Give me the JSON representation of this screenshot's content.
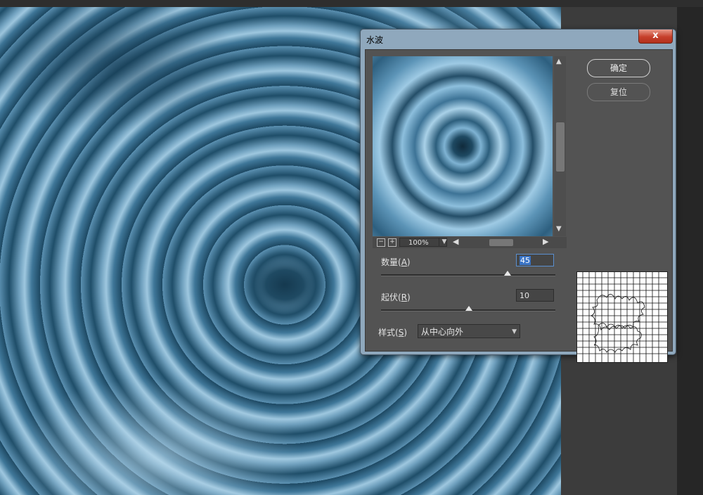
{
  "dialog": {
    "title": "水波",
    "close_label": "x",
    "ok_label": "确定",
    "reset_label": "复位"
  },
  "preview": {
    "zoom_minus_label": "−",
    "zoom_plus_label": "+",
    "zoom_level": "100%"
  },
  "params": {
    "amount": {
      "label": "数量",
      "hotkey": "A",
      "value": "45",
      "slider_fraction": 0.72
    },
    "ridges": {
      "label": "起伏",
      "hotkey": "R",
      "value": "10",
      "slider_fraction": 0.5
    },
    "style": {
      "label": "样式",
      "hotkey": "S",
      "selected": "从中心向外"
    }
  },
  "colors": {
    "dialog_frame": "#8fa8bd",
    "panel_bg": "#535353",
    "close_red": "#c6402b",
    "selection_blue": "#3a74c6"
  },
  "icons": {
    "close": "close-icon",
    "scroll_up": "arrow-up-icon",
    "scroll_down": "arrow-down-icon",
    "scroll_left": "arrow-left-icon",
    "scroll_right": "arrow-right-icon",
    "dropdown": "chevron-down-icon",
    "distortion_preview": "grid-distortion-icon"
  }
}
